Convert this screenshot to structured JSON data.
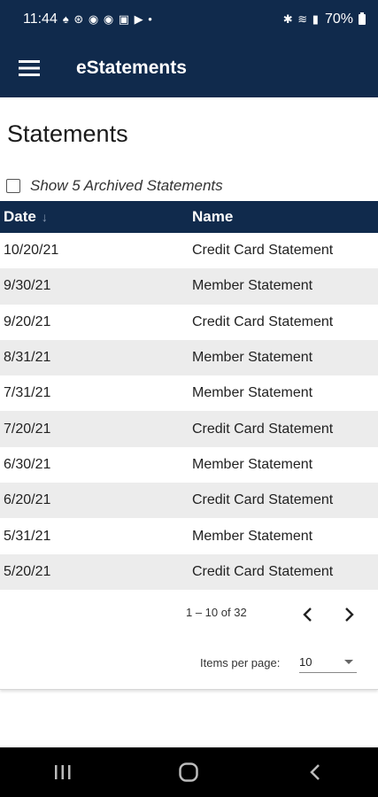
{
  "status_bar": {
    "time": "11:44",
    "left_icons": "♠ ⊛ ◉ ◉ ▣ ▶ •",
    "right_icons": "✱ ≋ ▮",
    "battery": "70%"
  },
  "app_bar": {
    "title": "eStatements"
  },
  "page": {
    "title": "Statements"
  },
  "archive": {
    "label": "Show 5 Archived Statements",
    "checked": false
  },
  "table": {
    "columns": {
      "date": "Date",
      "name": "Name",
      "sort_indicator": "↓"
    },
    "rows": [
      {
        "date": "10/20/21",
        "name": "Credit Card Statement"
      },
      {
        "date": "9/30/21",
        "name": "Member Statement"
      },
      {
        "date": "9/20/21",
        "name": "Credit Card Statement"
      },
      {
        "date": "8/31/21",
        "name": "Member Statement"
      },
      {
        "date": "7/31/21",
        "name": "Member Statement"
      },
      {
        "date": "7/20/21",
        "name": "Credit Card Statement"
      },
      {
        "date": "6/30/21",
        "name": "Member Statement"
      },
      {
        "date": "6/20/21",
        "name": "Credit Card Statement"
      },
      {
        "date": "5/31/21",
        "name": "Member Statement"
      },
      {
        "date": "5/20/21",
        "name": "Credit Card Statement"
      }
    ]
  },
  "paginator": {
    "range": "1 – 10 of 32",
    "items_per_page_label": "Items per page:",
    "items_per_page_value": "10"
  },
  "colors": {
    "primary": "#102a4c",
    "row_alt": "#ececec"
  }
}
